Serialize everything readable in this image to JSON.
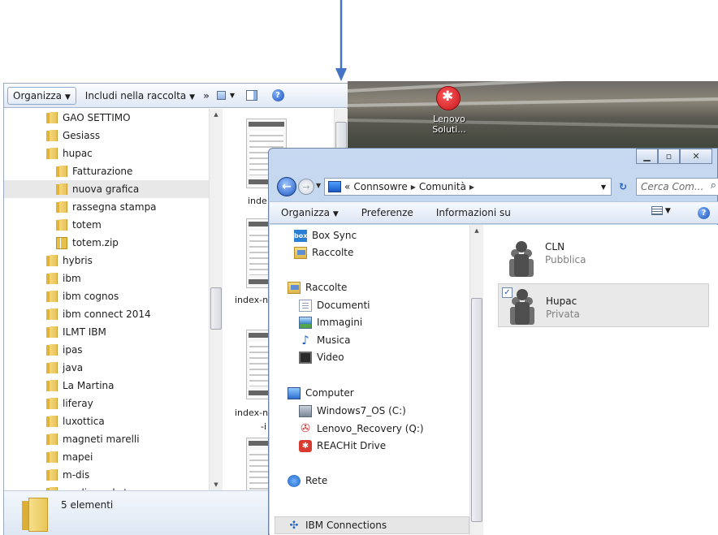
{
  "left_window": {
    "toolbar": {
      "organize": "Organizza",
      "include": "Includi nella raccolta",
      "more": "»"
    },
    "folders": [
      {
        "label": "GAO SETTIMO",
        "level": 0,
        "type": "folder"
      },
      {
        "label": "Gesiass",
        "level": 0,
        "type": "folder"
      },
      {
        "label": "hupac",
        "level": 0,
        "type": "folder"
      },
      {
        "label": "Fatturazione",
        "level": 1,
        "type": "folder"
      },
      {
        "label": "nuova grafica",
        "level": 1,
        "type": "folder",
        "selected": true
      },
      {
        "label": "rassegna stampa",
        "level": 1,
        "type": "folder"
      },
      {
        "label": "totem",
        "level": 1,
        "type": "folder"
      },
      {
        "label": "totem.zip",
        "level": 1,
        "type": "zip"
      },
      {
        "label": "hybris",
        "level": 0,
        "type": "folder"
      },
      {
        "label": "ibm",
        "level": 0,
        "type": "folder"
      },
      {
        "label": "ibm cognos",
        "level": 0,
        "type": "folder"
      },
      {
        "label": "ibm connect 2014",
        "level": 0,
        "type": "folder"
      },
      {
        "label": "ILMT IBM",
        "level": 0,
        "type": "folder"
      },
      {
        "label": "ipas",
        "level": 0,
        "type": "folder"
      },
      {
        "label": "java",
        "level": 0,
        "type": "folder"
      },
      {
        "label": "La Martina",
        "level": 0,
        "type": "folder"
      },
      {
        "label": "liferay",
        "level": 0,
        "type": "folder"
      },
      {
        "label": "luxottica",
        "level": 0,
        "type": "folder"
      },
      {
        "label": "magneti marelli",
        "level": 0,
        "type": "folder"
      },
      {
        "label": "mapei",
        "level": 0,
        "type": "folder"
      },
      {
        "label": "m-dis",
        "level": 0,
        "type": "folder"
      },
      {
        "label": "mediamarket",
        "level": 0,
        "type": "folder"
      }
    ],
    "thumb_labels": [
      "inde",
      "index-n",
      "index-n",
      "-i"
    ],
    "status": "5 elementi"
  },
  "desktop": {
    "icon_label_line1": "Lenovo",
    "icon_label_line2": "Soluti..."
  },
  "right_window": {
    "address": {
      "prefix": "«",
      "crumb1": "Connsowre",
      "crumb2": "Comunità"
    },
    "search_placeholder": "Cerca Com...",
    "toolbar": {
      "organize": "Organizza",
      "preferences": "Preferenze",
      "info": "Informazioni su"
    },
    "nav": {
      "box_sync": "Box Sync",
      "raccolte_fav": "Raccolte",
      "raccolte": "Raccolte",
      "documenti": "Documenti",
      "immagini": "Immagini",
      "musica": "Musica",
      "video": "Video",
      "computer": "Computer",
      "drive_c": "Windows7_OS (C:)",
      "drive_q": "Lenovo_Recovery (Q:)",
      "reachit": "REACHit Drive",
      "rete": "Rete",
      "ibm_connections": "IBM Connections"
    },
    "communities": [
      {
        "name": "CLN",
        "visibility": "Pubblica"
      },
      {
        "name": "Hupac",
        "visibility": "Privata"
      }
    ]
  },
  "colors": {
    "arrow": "#4472c4",
    "selection": "#e8e8e8",
    "folder": "#e8c25c"
  }
}
